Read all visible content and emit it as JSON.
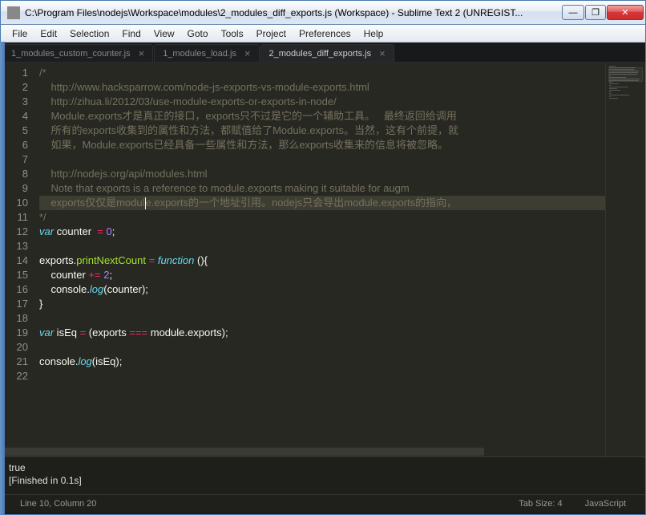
{
  "window": {
    "title": "C:\\Program Files\\nodejs\\Workspace\\modules\\2_modules_diff_exports.js (Workspace) - Sublime Text 2 (UNREGIST..."
  },
  "win_buttons": {
    "min": "—",
    "max": "❐",
    "close": "✕"
  },
  "menu": [
    "File",
    "Edit",
    "Selection",
    "Find",
    "View",
    "Goto",
    "Tools",
    "Project",
    "Preferences",
    "Help"
  ],
  "tabs": [
    {
      "label": "1_modules_custom_counter.js",
      "active": false
    },
    {
      "label": "1_modules_load.js",
      "active": false
    },
    {
      "label": "2_modules_diff_exports.js",
      "active": true
    }
  ],
  "code": {
    "lines": [
      {
        "n": 1,
        "segs": [
          {
            "t": "/*",
            "c": "c-comment"
          }
        ]
      },
      {
        "n": 2,
        "segs": [
          {
            "t": "    http://www.hacksparrow.com/node-js-exports-vs-module-exports.html",
            "c": "c-comment"
          }
        ]
      },
      {
        "n": 3,
        "segs": [
          {
            "t": "    http://zihua.li/2012/03/use-module-exports-or-exports-in-node/",
            "c": "c-comment"
          }
        ]
      },
      {
        "n": 4,
        "segs": [
          {
            "t": "    Module.exports才是真正的接口，exports只不过是它的一个辅助工具。   最终返回给调用",
            "c": "c-comment"
          }
        ]
      },
      {
        "n": 5,
        "segs": [
          {
            "t": "    所有的exports收集到的属性和方法，都赋值给了Module.exports。当然，这有个前提，就",
            "c": "c-comment"
          }
        ]
      },
      {
        "n": 6,
        "segs": [
          {
            "t": "    如果，Module.exports已经具备一些属性和方法，那么exports收集来的信息将被忽略。",
            "c": "c-comment"
          }
        ]
      },
      {
        "n": 7,
        "segs": [
          {
            "t": "",
            "c": "c-comment"
          }
        ]
      },
      {
        "n": 8,
        "segs": [
          {
            "t": "    http://nodejs.org/api/modules.html",
            "c": "c-comment"
          }
        ]
      },
      {
        "n": 9,
        "segs": [
          {
            "t": "    Note that exports is a reference to module.exports making it suitable for augm",
            "c": "c-comment"
          }
        ]
      },
      {
        "n": 10,
        "segs": [
          {
            "t": "    exports仅仅是modul",
            "c": "c-comment"
          },
          {
            "t": "|",
            "c": "caret-marker"
          },
          {
            "t": "e.exports的一个地址引用。nodejs只会导出module.exports的指向，",
            "c": "c-comment"
          }
        ],
        "hl": true
      },
      {
        "n": 11,
        "segs": [
          {
            "t": "*/",
            "c": "c-comment"
          }
        ]
      },
      {
        "n": 12,
        "segs": [
          {
            "t": "var",
            "c": "c-storage"
          },
          {
            "t": " counter  ",
            "c": "c-var"
          },
          {
            "t": "=",
            "c": "c-op"
          },
          {
            "t": " ",
            "c": ""
          },
          {
            "t": "0",
            "c": "c-num"
          },
          {
            "t": ";",
            "c": ""
          }
        ]
      },
      {
        "n": 13,
        "segs": []
      },
      {
        "n": 14,
        "segs": [
          {
            "t": "exports",
            "c": "c-var"
          },
          {
            "t": ".",
            "c": ""
          },
          {
            "t": "printNextCount",
            "c": "c-name"
          },
          {
            "t": " ",
            "c": ""
          },
          {
            "t": "=",
            "c": "c-op"
          },
          {
            "t": " ",
            "c": ""
          },
          {
            "t": "function",
            "c": "c-storage"
          },
          {
            "t": " (){",
            "c": ""
          }
        ]
      },
      {
        "n": 15,
        "segs": [
          {
            "t": "    counter ",
            "c": "c-var"
          },
          {
            "t": "+=",
            "c": "c-op"
          },
          {
            "t": " ",
            "c": ""
          },
          {
            "t": "2",
            "c": "c-num"
          },
          {
            "t": ";",
            "c": ""
          }
        ]
      },
      {
        "n": 16,
        "segs": [
          {
            "t": "    console",
            "c": "c-var"
          },
          {
            "t": ".",
            "c": ""
          },
          {
            "t": "log",
            "c": "c-key"
          },
          {
            "t": "(counter);",
            "c": ""
          }
        ]
      },
      {
        "n": 17,
        "segs": [
          {
            "t": "}",
            "c": ""
          }
        ]
      },
      {
        "n": 18,
        "segs": []
      },
      {
        "n": 19,
        "segs": [
          {
            "t": "var",
            "c": "c-storage"
          },
          {
            "t": " isEq ",
            "c": "c-var"
          },
          {
            "t": "=",
            "c": "c-op"
          },
          {
            "t": " (exports ",
            "c": ""
          },
          {
            "t": "===",
            "c": "c-op"
          },
          {
            "t": " module",
            "c": "c-var"
          },
          {
            "t": ".",
            "c": ""
          },
          {
            "t": "exports",
            "c": "c-var"
          },
          {
            "t": ");",
            "c": ""
          }
        ]
      },
      {
        "n": 20,
        "segs": []
      },
      {
        "n": 21,
        "segs": [
          {
            "t": "console",
            "c": "c-var"
          },
          {
            "t": ".",
            "c": ""
          },
          {
            "t": "log",
            "c": "c-key"
          },
          {
            "t": "(isEq);",
            "c": ""
          }
        ]
      },
      {
        "n": 22,
        "segs": []
      }
    ]
  },
  "console": {
    "line1": "true",
    "line2": "[Finished in 0.1s]"
  },
  "status": {
    "left": "Line 10, Column 20",
    "tabsize": "Tab Size: 4",
    "lang": "JavaScript"
  }
}
